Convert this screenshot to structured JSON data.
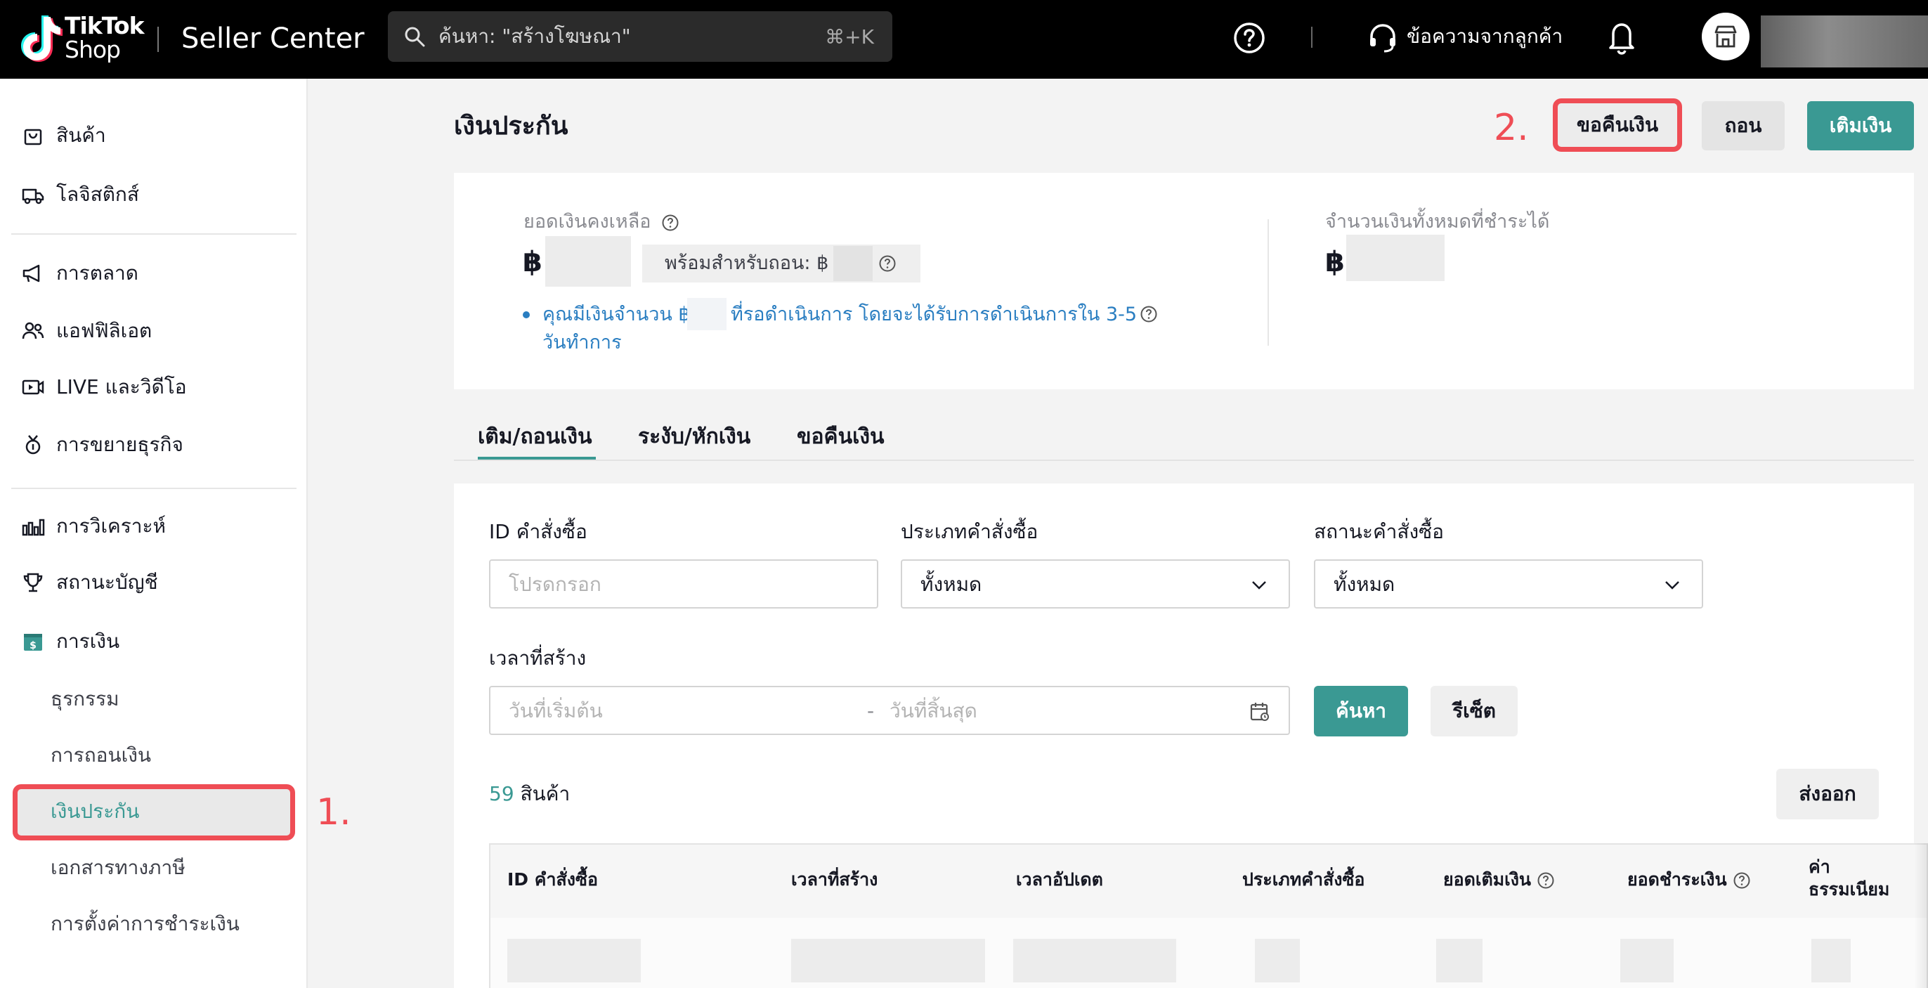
{
  "header": {
    "logo_line1": "TikTok",
    "logo_line2": "Shop",
    "app_title": "Seller Center",
    "search_placeholder": "ค้นหา: \"สร้างโฆษณา\"",
    "search_shortcut": "⌘+K",
    "customer_messages": "ข้อความจากลูกค้า"
  },
  "sidebar": {
    "items": [
      {
        "label": "สินค้า",
        "icon": "bag-icon"
      },
      {
        "label": "โลจิสติกส์",
        "icon": "truck-icon"
      },
      {
        "label": "การตลาด",
        "icon": "megaphone-icon"
      },
      {
        "label": "แอฟฟิลิเอต",
        "icon": "users-icon"
      },
      {
        "label": "LIVE และวิดีโอ",
        "icon": "video-icon"
      },
      {
        "label": "การขยายธุรกิจ",
        "icon": "medal-icon"
      },
      {
        "label": "การวิเคราะห์",
        "icon": "chart-icon"
      },
      {
        "label": "สถานะบัญชี",
        "icon": "trophy-icon"
      },
      {
        "label": "การเงิน",
        "icon": "finance-icon"
      }
    ],
    "finance_sub": [
      "ธุรกรรม",
      "การถอนเงิน",
      "เงินประกัน",
      "เอกสารทางภาษี",
      "การตั้งค่าการชำระเงิน"
    ],
    "active_sub": "เงินประกัน"
  },
  "annotations": {
    "step1": "1.",
    "step2": "2."
  },
  "page": {
    "title": "เงินประกัน",
    "btn_refund": "ขอคืนเงิน",
    "btn_withdraw": "ถอน",
    "btn_topup": "เติมเงิน"
  },
  "balance": {
    "label": "ยอดเงินคงเหลือ",
    "currency": "฿",
    "available": "พร้อมสำหรับถอน: ฿",
    "pending_part1": "คุณมีเงินจำนวน ฿",
    "pending_part2": "ที่รอดำเนินการ โดยจะได้รับการดำเนินการใน 3-5",
    "pending_part3": "วันทำการ",
    "total_label": "จำนวนเงินทั้งหมดที่ชำระได้",
    "total_currency": "฿"
  },
  "tabs": [
    "เติม/ถอนเงิน",
    "ระงับ/หักเงิน",
    "ขอคืนเงิน"
  ],
  "filters": {
    "order_id_label": "ID คำสั่งซื้อ",
    "order_id_placeholder": "โปรดกรอก",
    "order_type_label": "ประเภทคำสั่งซื้อ",
    "order_type_value": "ทั้งหมด",
    "order_status_label": "สถานะคำสั่งซื้อ",
    "order_status_value": "ทั้งหมด",
    "created_time_label": "เวลาที่สร้าง",
    "start_placeholder": "วันที่เริ่มต้น",
    "range_dash": "-",
    "end_placeholder": "วันที่สิ้นสุด",
    "search_btn": "ค้นหา",
    "reset_btn": "รีเซ็ต"
  },
  "results": {
    "count": "59",
    "count_suffix": "สินค้า",
    "export_btn": "ส่งออก"
  },
  "table": {
    "columns": [
      "ID คำสั่งซื้อ",
      "เวลาที่สร้าง",
      "เวลาอัปเดต",
      "ประเภทคำสั่งซื้อ",
      "ยอดเติมเงิน",
      "ยอดชำระเงิน"
    ],
    "fee_line1": "ค่า",
    "fee_line2": "ธรรมเนียม"
  },
  "colors": {
    "accent": "#3a9993",
    "annotation": "#ef4d55",
    "link": "#2a7ec1"
  }
}
